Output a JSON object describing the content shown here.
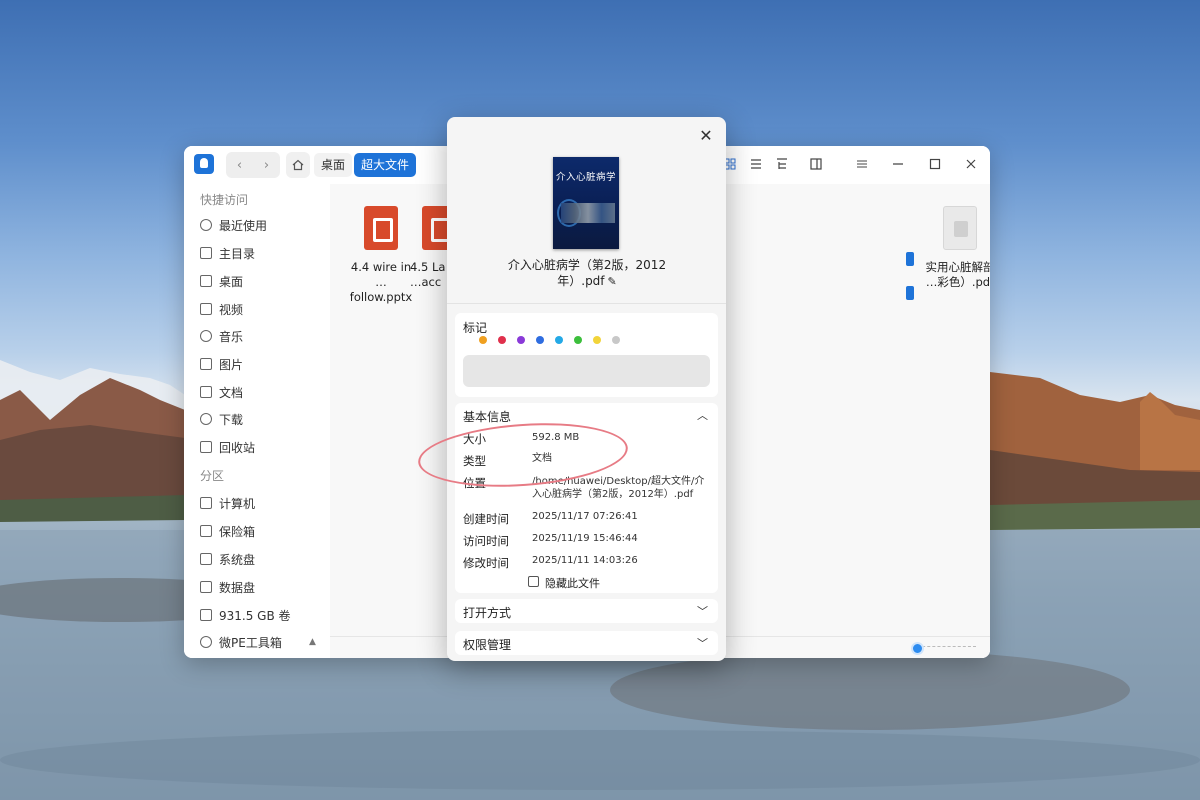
{
  "file_manager": {
    "breadcrumb": [
      "桌面",
      "超大文件"
    ],
    "sidebar": {
      "quick_access_title": "快捷访问",
      "items": [
        "最近使用",
        "主目录",
        "桌面",
        "视频",
        "音乐",
        "图片",
        "文档",
        "下载",
        "回收站"
      ],
      "partition_title": "分区",
      "partitions": [
        "计算机",
        "保险箱",
        "系统盘",
        "数据盘",
        "931.5 GB 卷",
        "微PE工具箱"
      ]
    },
    "files": [
      {
        "line1": "4.4 wire in",
        "line2": "… follow.pptx",
        "icon": "pptx-icon"
      },
      {
        "line1": "4.5 La",
        "line2": "…acc",
        "icon": "pptx-icon"
      },
      {
        "line1": "实用心脏解剖",
        "line2": "…彩色）.pdf",
        "icon": "pdf-icon"
      }
    ]
  },
  "properties": {
    "cover_title": "介入心脏病学",
    "filename_line1": "介入心脏病学（第2版，2012",
    "filename_line2": "年）.pdf",
    "tags_title": "标记",
    "tag_colors": [
      "#f0a020",
      "#e0304c",
      "#8a3ad8",
      "#2f6de0",
      "#24a9e6",
      "#3cbf3c",
      "#f2d43a",
      "#c8c8c8"
    ],
    "basic_info_title": "基本信息",
    "info": [
      {
        "label": "大小",
        "value": "592.8 MB"
      },
      {
        "label": "类型",
        "value": "文档"
      },
      {
        "label": "位置",
        "value": "/home/huawei/Desktop/超大文件/介入心脏病学（第2版，2012年）.pdf"
      },
      {
        "label": "创建时间",
        "value": "2025/11/17 07:26:41"
      },
      {
        "label": "访问时间",
        "value": "2025/11/19 15:46:44"
      },
      {
        "label": "修改时间",
        "value": "2025/11/11 14:03:26"
      }
    ],
    "hide_file_label": "隐藏此文件",
    "open_with_title": "打开方式",
    "permissions_title": "权限管理"
  }
}
